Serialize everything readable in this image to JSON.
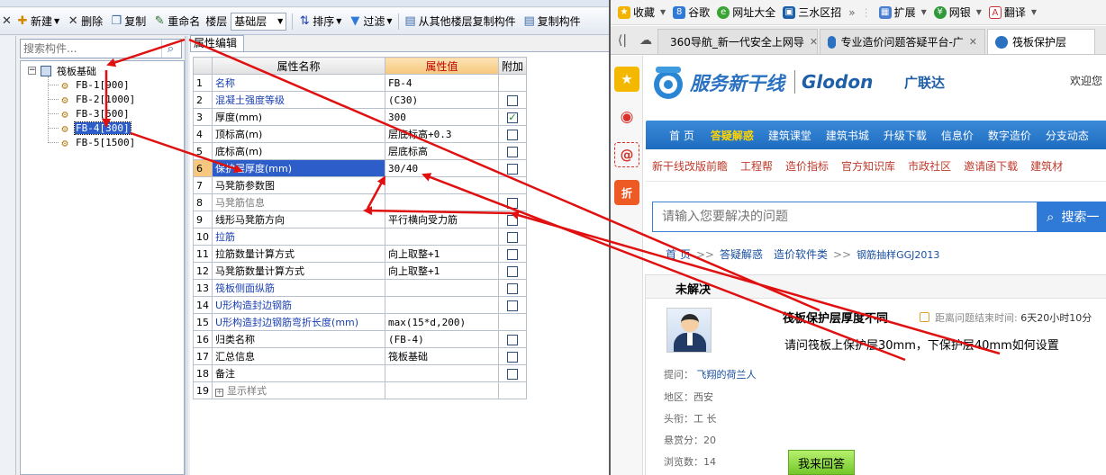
{
  "toolbar": {
    "new_label": "新建",
    "delete_label": "删除",
    "copy_label": "复制",
    "rename_label": "重命名",
    "floor_label": "楼层",
    "floor_value": "基础层",
    "sort_label": "排序",
    "filter_label": "过滤",
    "copy_from_floor_label": "从其他楼层复制构件",
    "copy_to_label": "复制构件"
  },
  "component_search": {
    "placeholder": "搜索构件..."
  },
  "tree": {
    "group_label": "筏板基础",
    "items": [
      "FB-1[900]",
      "FB-2[1000]",
      "FB-3[500]",
      "FB-4[300]",
      "FB-5[1500]"
    ],
    "selected_index": 3
  },
  "property_panel": {
    "tab_label": "属性编辑",
    "headers": {
      "name": "属性名称",
      "value": "属性值",
      "extra": "附加"
    },
    "rows": [
      {
        "no": "1",
        "name": "名称",
        "value": "FB-4",
        "check": "none",
        "color": "blue"
      },
      {
        "no": "2",
        "name": "混凝土强度等级",
        "value": "(C30)",
        "check": "unchecked",
        "color": "blue"
      },
      {
        "no": "3",
        "name": "厚度(mm)",
        "value": "300",
        "check": "checked",
        "color": "black"
      },
      {
        "no": "4",
        "name": "顶标高(m)",
        "value": "层底标高+0.3",
        "check": "unchecked",
        "color": "black"
      },
      {
        "no": "5",
        "name": "底标高(m)",
        "value": "层底标高",
        "check": "unchecked",
        "color": "black"
      },
      {
        "no": "6",
        "name": "保护层厚度(mm)",
        "value": "30/40",
        "check": "unchecked",
        "color": "selected"
      },
      {
        "no": "7",
        "name": "马凳筋参数图",
        "value": "",
        "check": "none",
        "color": "black"
      },
      {
        "no": "8",
        "name": "马凳筋信息",
        "value": "",
        "check": "unchecked",
        "color": "gray"
      },
      {
        "no": "9",
        "name": "线形马凳筋方向",
        "value": "平行横向受力筋",
        "check": "unchecked",
        "color": "black"
      },
      {
        "no": "10",
        "name": "拉筋",
        "value": "",
        "check": "unchecked",
        "color": "blue"
      },
      {
        "no": "11",
        "name": "拉筋数量计算方式",
        "value": "向上取整+1",
        "check": "unchecked",
        "color": "black"
      },
      {
        "no": "12",
        "name": "马凳筋数量计算方式",
        "value": "向上取整+1",
        "check": "unchecked",
        "color": "black"
      },
      {
        "no": "13",
        "name": "筏板侧面纵筋",
        "value": "",
        "check": "unchecked",
        "color": "blue"
      },
      {
        "no": "14",
        "name": "U形构造封边钢筋",
        "value": "",
        "check": "unchecked",
        "color": "blue"
      },
      {
        "no": "15",
        "name": "U形构造封边钢筋弯折长度(mm)",
        "value": "max(15*d,200)",
        "check": "none",
        "color": "blue"
      },
      {
        "no": "16",
        "name": "归类名称",
        "value": "(FB-4)",
        "check": "unchecked",
        "color": "black"
      },
      {
        "no": "17",
        "name": "汇总信息",
        "value": "筏板基础",
        "check": "unchecked",
        "color": "black"
      },
      {
        "no": "18",
        "name": "备注",
        "value": "",
        "check": "unchecked",
        "color": "black"
      },
      {
        "no": "19",
        "name": "显示样式",
        "value": "",
        "check": "none",
        "color": "gray",
        "expandable": true
      }
    ]
  },
  "browser": {
    "bookmarks": [
      "收藏",
      "谷歌",
      "网址大全",
      "三水区招",
      "扩展",
      "网银",
      "翻译"
    ],
    "tabs": [
      "360导航_新一代安全上网导",
      "专业造价问题答疑平台-广",
      "筏板保护层"
    ],
    "page": {
      "logo_text": "服务新干线",
      "brand_en": "Glodon",
      "brand_cn": "广联达",
      "welcome": "欢迎您",
      "nav_main": [
        "首 页",
        "答疑解惑",
        "建筑课堂",
        "建筑书城",
        "升级下载",
        "信息价",
        "数字造价",
        "分支动态"
      ],
      "nav_sub": [
        "新干线改版前瞻",
        "工程帮",
        "造价指标",
        "官方知识库",
        "市政社区",
        "邀请函下载",
        "建筑材"
      ],
      "search_placeholder": "请输入您要解决的问题",
      "search_button": "搜索一",
      "breadcrumb": [
        "首 页",
        "答疑解惑",
        "造价软件类",
        "钢筋抽样GGJ2013"
      ],
      "status": "未解决",
      "question_title": "筏板保护层厚度不同",
      "timer_label": "距离问题结束时间:",
      "timer_value": "6天20小时10分",
      "question_body": "请问筏板上保护层30mm，下保护层40mm如何设置",
      "asker_label": "提问：",
      "asker_name": "飞翔的荷兰人",
      "region_label": "地区：西安",
      "title_label": "头衔：工  长",
      "bounty_label": "悬赏分：20",
      "views_label": "浏览数：14",
      "answer_button": "我来回答"
    }
  }
}
